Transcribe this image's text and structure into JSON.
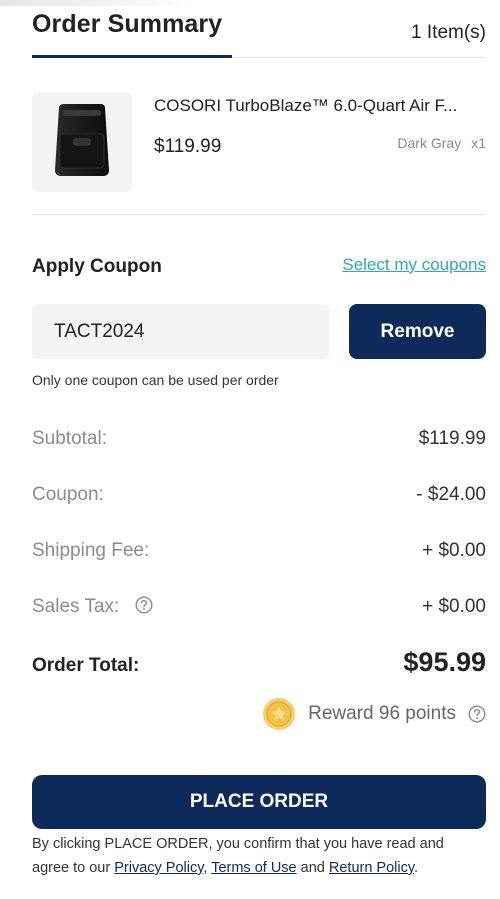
{
  "header": {
    "title": "Order Summary",
    "item_count": "1 Item(s)"
  },
  "product": {
    "name": "COSORI TurboBlaze™ 6.0-Quart Air F...",
    "price": "$119.99",
    "color": "Dark Gray",
    "quantity": "x1",
    "image_icon": "air-fryer-image"
  },
  "coupon": {
    "title": "Apply Coupon",
    "select_link": "Select my coupons",
    "code": "TACT2024",
    "remove_label": "Remove",
    "note": "Only one coupon can be used per order"
  },
  "summary": {
    "subtotal_label": "Subtotal:",
    "subtotal_value": "$119.99",
    "coupon_label": "Coupon:",
    "coupon_value": "- $24.00",
    "shipping_label": "Shipping Fee:",
    "shipping_value": "+ $0.00",
    "tax_label": "Sales Tax:",
    "tax_value": "+ $0.00",
    "total_label": "Order Total:",
    "total_value": "$95.99"
  },
  "reward": {
    "text": "Reward 96 points",
    "icon": "coin-icon"
  },
  "place_order": {
    "label": "PLACE ORDER"
  },
  "legal": {
    "prefix": "By clicking PLACE ORDER, you confirm that you have read and agree to our ",
    "privacy": "Privacy Policy",
    "sep1": ", ",
    "terms": "Terms of Use",
    "sep2": " and ",
    "return": "Return Policy",
    "suffix": "."
  },
  "colors": {
    "primary": "#0e2a5b",
    "link": "#2aa9b8",
    "muted_label": "#8c8c8c",
    "coin": "#f2c34a"
  }
}
